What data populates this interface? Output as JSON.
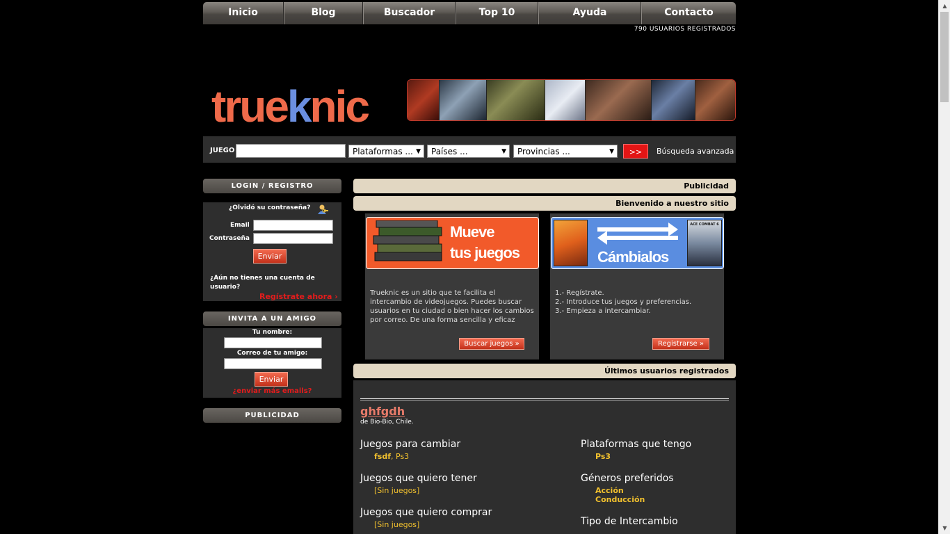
{
  "nav": {
    "items": [
      "Inicio",
      "Blog",
      "Buscador",
      "Top 10",
      "Ayuda",
      "Contacto"
    ],
    "user_count": "790 USUARIOS REGISTRADOS"
  },
  "logo": {
    "part1": "true",
    "part2": "k",
    "part3": "nic"
  },
  "search": {
    "label": "JUEGO",
    "game_value": "",
    "platform": "Plataformas ...",
    "country": "Países ...",
    "province": "Provincias ...",
    "go_label": ">>",
    "advanced_label": "Búsqueda avanzada"
  },
  "login": {
    "title": "LOGIN / REGISTRO",
    "forgot": "¿Olvidó su contraseña?",
    "email_label": "Email",
    "password_label": "Contraseña",
    "submit": "Enviar",
    "no_account": "¿Aún no tienes una cuenta de usuario?",
    "register_link": "Regístrate ahora"
  },
  "invite": {
    "title": "INVITA A UN AMIGO",
    "name_label": "Tu nombre:",
    "friend_label": "Correo de tu amigo:",
    "submit": "Enviar",
    "more_link": "¿enviar más emails?"
  },
  "left_ad": {
    "title": "PUBLICIDAD"
  },
  "right": {
    "ad_title": "Publicidad",
    "welcome_title": "Bienvenido a nuestro sitio",
    "promo1": {
      "image_line1": "Mueve",
      "image_line2": "tus juegos",
      "text": "Trueknic es un sitio que te facilita el intercambio de videojuegos. Puedes buscar usuarios en tu ciudad o bien hacer los cambios por correo. De una forma sencilla y eficaz",
      "button": "Buscar juegos »"
    },
    "promo2": {
      "image_text": "Cámbialos",
      "cover_title": "ACE COMBAT 6",
      "steps": [
        "1.- Regístrate.",
        "2.- Introduce tus juegos y preferencias.",
        "3.- Empieza a intercambiar."
      ],
      "button": "Registrarse »"
    },
    "latest_title": "Últimos usuarios registrados"
  },
  "latest_user": {
    "username": "ghfgdh",
    "location": "de Bio-Bio, Chile.",
    "to_trade_title": "Juegos para cambiar",
    "to_trade_game": "fsdf",
    "to_trade_sep": ", ",
    "to_trade_platform": "Ps3",
    "want_title": "Juegos que quiero tener",
    "want_value": "[Sin juegos]",
    "buy_title": "Juegos que quiero comprar",
    "buy_value": "[Sin juegos]",
    "platforms_title": "Plataformas que tengo",
    "platforms_value": "Ps3",
    "genres_title": "Géneros preferidos",
    "genres": [
      "Acción",
      "Conducción"
    ],
    "exchange_title": "Tipo de Intercambio"
  },
  "colors": {
    "logo_orange": "#ef6a4a",
    "logo_blue": "#6b8fe0",
    "accent_red": "#e31515",
    "header_beige": "#e2d7c2",
    "yellow_text": "#f2c12e"
  }
}
